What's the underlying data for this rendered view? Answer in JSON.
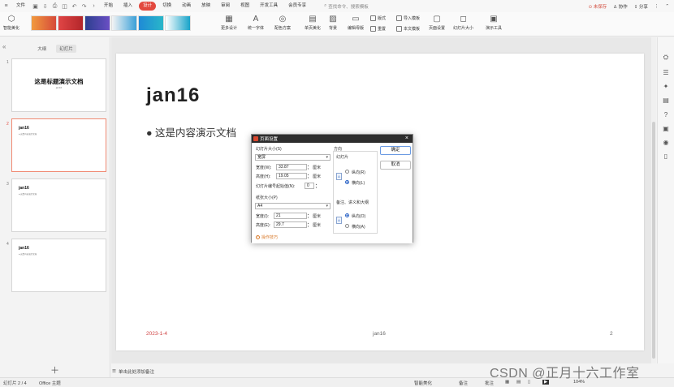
{
  "menubar": {
    "file_label": "文件",
    "tabs": [
      "开始",
      "插入",
      "设计",
      "切换",
      "动画",
      "放映",
      "审阅",
      "视图",
      "开发工具",
      "会员专享"
    ],
    "active_tab": "设计",
    "search_placeholder": "查找命令、搜索模板",
    "unsaved": "未保存",
    "collab": "协作",
    "share": "分享"
  },
  "ribbon": {
    "smart_beautify": "智能美化",
    "more_designs": "更多设计",
    "unify_font": "统一字体",
    "color_scheme": "配色方案",
    "single_page_beautify": "单页美化",
    "background": "背景",
    "edit_master": "编辑母版",
    "layout": "版式",
    "import_template": "导入模板",
    "reset": "重置",
    "text_template": "本文模板",
    "page_setup": "页面设置",
    "slide_size": "幻灯片大小",
    "presenter_tools": "演示工具"
  },
  "left_panel": {
    "tab_outline": "大纲",
    "tab_slides": "幻灯片",
    "thumbnails": [
      {
        "num": "1",
        "title": "这是标题演示文档",
        "body": "jan16"
      },
      {
        "num": "2",
        "title": "jan16",
        "body": "● 这是内容演示文档"
      },
      {
        "num": "3",
        "title": "jan16",
        "body": "● 这是内容演示文档"
      },
      {
        "num": "4",
        "title": "jan16",
        "body": "● 这是内容演示文档"
      }
    ]
  },
  "slide": {
    "title": "jan16",
    "body": "● 这是内容演示文档",
    "date": "2023-1-4",
    "footer": "jan16",
    "number": "2"
  },
  "notes_hint": "单击此处添加备注",
  "statusbar": {
    "slide_info": "幻灯片 2 / 4",
    "theme": "Office 主题",
    "smart_beautify": "智能美化",
    "notes": "备注",
    "comments": "批注",
    "zoom": "104%"
  },
  "watermark": "CSDN @正月十六工作室",
  "dialog": {
    "title": "页面设置",
    "slide_size_label": "幻灯片大小(S)",
    "slide_size_value": "宽屏",
    "width_label": "宽度(W):",
    "width_value": "33.87",
    "height_label": "高度(H):",
    "height_value": "19.05",
    "start_num_label": "幻灯片编号起始值(N):",
    "start_num_value": "0",
    "unit": "厘米",
    "paper_size_label": "纸张大小(P)",
    "paper_size_value": "A4",
    "paper_width_label": "宽度(I):",
    "paper_width_value": "21",
    "paper_height_label": "高度(E):",
    "paper_height_value": "29.7",
    "orientation_label": "方向",
    "slides_label": "幻灯片",
    "portrait": "纵向(R)",
    "landscape": "横向(L)",
    "notes_label": "备注、讲义和大纲",
    "notes_portrait": "纵向(O)",
    "notes_landscape": "横向(A)",
    "ok": "确定",
    "cancel": "取消",
    "help": "操作技巧"
  }
}
